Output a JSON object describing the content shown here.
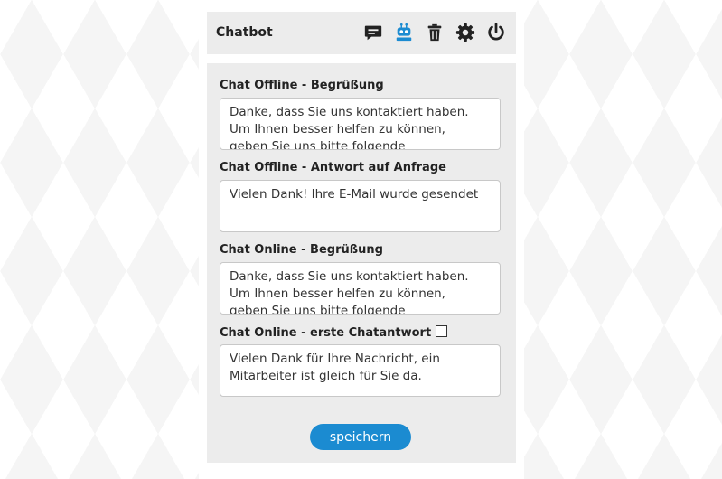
{
  "header": {
    "title": "Chatbot",
    "icons": [
      "chat-bubble-icon",
      "robot-icon",
      "trash-icon",
      "gear-icon",
      "power-icon"
    ],
    "active_icon_color": "#1b8bd1"
  },
  "fields": [
    {
      "label": "Chat Offline - Begrüßung",
      "value": "Danke, dass Sie uns kontaktiert haben. Um Ihnen besser helfen zu können, geben Sie uns bitte folgende"
    },
    {
      "label": "Chat Offline - Antwort auf Anfrage",
      "value": "Vielen Dank! Ihre E-Mail wurde gesendet"
    },
    {
      "label": "Chat Online - Begrüßung",
      "value": "Danke, dass Sie uns kontaktiert haben. Um Ihnen besser helfen zu können, geben Sie uns bitte folgende"
    },
    {
      "label": "Chat Online - erste Chatantwort",
      "checkbox_checked": false,
      "value": "Vielen Dank für Ihre Nachricht, ein Mitarbeiter ist gleich für Sie da."
    }
  ],
  "save_label": "speichern",
  "accent_color": "#1b8bd1"
}
